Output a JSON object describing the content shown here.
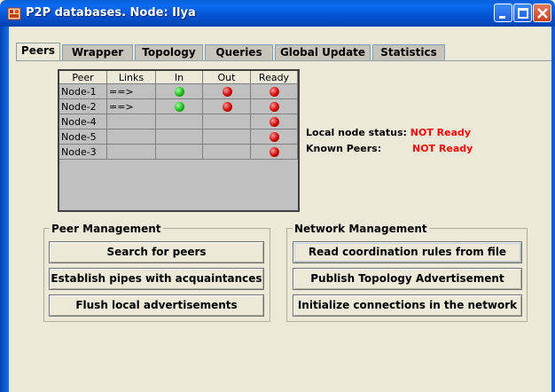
{
  "window": {
    "title": "P2P databases. Node: Ilya"
  },
  "tabs": [
    {
      "label": "Peers",
      "active": true
    },
    {
      "label": "Wrapper",
      "active": false
    },
    {
      "label": "Topology",
      "active": false
    },
    {
      "label": "Queries",
      "active": false
    },
    {
      "label": "Global Update",
      "active": false
    },
    {
      "label": "Statistics",
      "active": false
    }
  ],
  "peer_table": {
    "columns": [
      "Peer",
      "Links",
      "In",
      "Out",
      "Ready"
    ],
    "rows": [
      {
        "peer": "Node-1",
        "links": "==>",
        "in": "green",
        "out": "red",
        "ready": "red"
      },
      {
        "peer": "Node-2",
        "links": "==>",
        "in": "green",
        "out": "red",
        "ready": "red"
      },
      {
        "peer": "Node-4",
        "links": "",
        "in": "",
        "out": "",
        "ready": "red"
      },
      {
        "peer": "Node-5",
        "links": "",
        "in": "",
        "out": "",
        "ready": "red"
      },
      {
        "peer": "Node-3",
        "links": "",
        "in": "",
        "out": "",
        "ready": "red"
      }
    ]
  },
  "status": {
    "local_label": "Local node status:",
    "local_value": "NOT Ready",
    "peers_label": "Known Peers:",
    "peers_value": "NOT Ready"
  },
  "peer_management": {
    "title": "Peer Management",
    "buttons": [
      "Search for peers",
      "Establish pipes with acquaintances",
      "Flush local advertisements"
    ]
  },
  "network_management": {
    "title": "Network Management",
    "buttons": [
      "Read coordination rules from file",
      "Publish Topology Advertisement",
      "Initialize connections in the network"
    ]
  },
  "colors": {
    "status_red": "#ff0000",
    "dot_green": "#1db91d",
    "dot_red": "#d20000",
    "title_blue": "#0a5ed8"
  }
}
